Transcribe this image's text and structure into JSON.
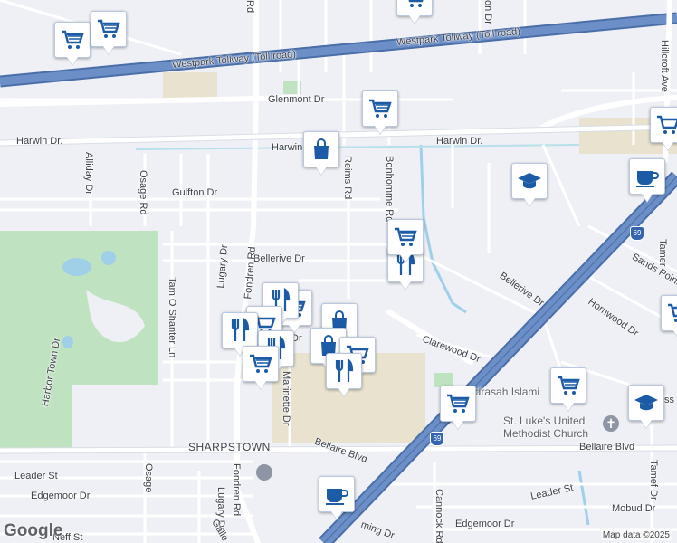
{
  "map": {
    "streets": {
      "westpark": "Westpark Tollway (Toll road)",
      "glenmont": "Glenmont Dr",
      "harwin_left": "Harwin Dr.",
      "harwin_mid": "Harwin",
      "harwin_right": "Harwin Dr.",
      "gulfton": "Gulfton Dr",
      "bellerive_left": "Bellerive Dr",
      "bellerive_right": "Bellerive Dr",
      "clarewood": "Clarewood Dr",
      "bellaire_left": "Bellaire Blvd",
      "bellaire_mid": "Bellaire Blvd",
      "bellaire_right": "Bellaire Blvd",
      "sharpstown": "SHARPSTOWN",
      "leader_left": "Leader St",
      "leader_right": "Leader St",
      "edgemoor_left": "Edgemoor Dr",
      "edgemoor_right": "Edgemoor Dr",
      "neff": "Neff St",
      "mobud": "Mobud Dr",
      "alliday": "Alliday Dr",
      "osage_top": "Osage Rd",
      "osage_bottom": "Osage",
      "tam_o_shanter": "Tam O Shanter Ln",
      "harbor_town": "Harbor Town Dr",
      "lugary": "Lugary Dr",
      "lugary_bottom": "Lugary Dr",
      "fondren_top": "Fondren Rd",
      "fondren_bottom": "Fondren Rd",
      "reims": "Reims Rd",
      "bonhomme": "Bonhomme Rd",
      "marinette": "Marinette Dr",
      "hillcroft": "Hillcroft Ave",
      "tamarind": "Tamer",
      "sands_point": "Sands Point",
      "hornwood": "Hornwood Dr",
      "cannock": "Cannock Rd",
      "tarnef": "Tamef Dr",
      "galle": "Galle",
      "ming": "ming Dr",
      "dr_fragment": "Dr",
      "ss_fragment": "ss",
      "on_fragment": "on Dr",
      "rd_fragment": "Rd"
    },
    "pois": {
      "madrasah": "Madrasah Islami",
      "st_lukes_1": "St. Luke's United",
      "st_lukes_2": "Methodist Church"
    },
    "highway_shields": [
      "69",
      "69"
    ],
    "attribution": "Map data ©2025",
    "logo": "Google",
    "colors": {
      "background": "#eef0f5",
      "street": "#ffffff",
      "highway": "#6c8fc7",
      "highway_outline": "#4a6ea8",
      "park": "#bfe3c0",
      "water": "#9fd0e8",
      "commercial": "#e8e2cf",
      "pin_icon": "#1c5ba6"
    },
    "markers": [
      {
        "type": "grocery-icon"
      },
      {
        "type": "grocery-icon"
      },
      {
        "type": "grocery-icon"
      },
      {
        "type": "shopping-bag-icon"
      },
      {
        "type": "school-icon"
      },
      {
        "type": "coffee-icon"
      },
      {
        "type": "grocery-icon"
      },
      {
        "type": "restaurant-icon"
      },
      {
        "type": "grocery-icon"
      },
      {
        "type": "grocery-icon"
      },
      {
        "type": "shopping-bag-icon"
      },
      {
        "type": "restaurant-icon"
      },
      {
        "type": "grocery-icon"
      },
      {
        "type": "restaurant-icon"
      },
      {
        "type": "grocery-icon"
      },
      {
        "type": "shopping-bag-icon"
      },
      {
        "type": "restaurant-icon"
      },
      {
        "type": "grocery-icon"
      },
      {
        "type": "grocery-icon"
      },
      {
        "type": "school-icon"
      },
      {
        "type": "coffee-icon"
      },
      {
        "type": "grocery-icon"
      },
      {
        "type": "grocery-icon"
      }
    ]
  }
}
